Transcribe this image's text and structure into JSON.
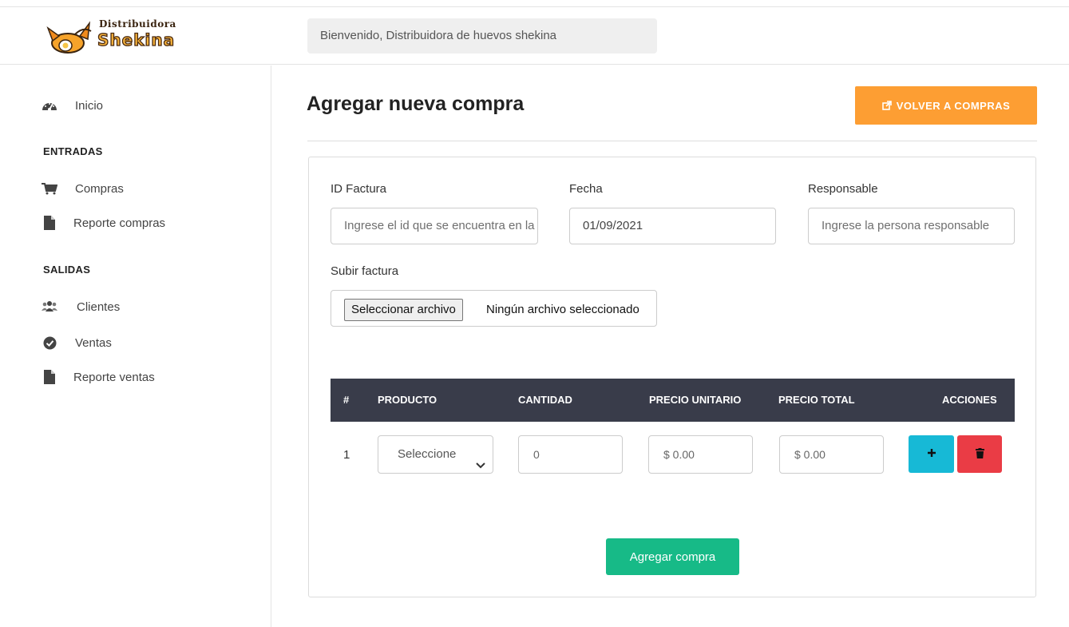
{
  "brand": {
    "line1": "Distribuidora",
    "line2": "Shekina"
  },
  "header": {
    "welcome": "Bienvenido, Distribuidora de huevos shekina"
  },
  "sidebar": {
    "home": {
      "label": "Inicio",
      "icon": "dashboard-icon"
    },
    "sections": [
      {
        "title": "ENTRADAS",
        "items": [
          {
            "label": "Compras",
            "icon": "cart-icon"
          },
          {
            "label": "Reporte compras",
            "icon": "document-icon"
          }
        ]
      },
      {
        "title": "SALIDAS",
        "items": [
          {
            "label": "Clientes",
            "icon": "users-icon"
          },
          {
            "label": "Ventas",
            "icon": "check-circle-icon"
          },
          {
            "label": "Reporte ventas",
            "icon": "document-icon"
          }
        ]
      }
    ]
  },
  "page": {
    "title": "Agregar nueva compra",
    "back_button": "VOLVER A COMPRAS",
    "accent_color": "#fd9e33"
  },
  "form": {
    "invoice_id": {
      "label": "ID Factura",
      "placeholder": "Ingrese el id que se encuentra en la factura",
      "value": ""
    },
    "date": {
      "label": "Fecha",
      "value": "01/09/2021"
    },
    "responsible": {
      "label": "Responsable",
      "placeholder": "Ingrese la persona responsable",
      "value": ""
    },
    "upload": {
      "label": "Subir factura",
      "button": "Seleccionar archivo",
      "status": "Ningún archivo seleccionado"
    }
  },
  "table": {
    "columns": [
      "#",
      "PRODUCTO",
      "CANTIDAD",
      "PRECIO UNITARIO",
      "PRECIO TOTAL",
      "ACCIONES"
    ],
    "rows": [
      {
        "index": "1",
        "product": "Seleccione",
        "quantity": "0",
        "unit_price": "$ 0.00",
        "total_price": "$ 0.00"
      }
    ]
  },
  "submit_button": "Agregar compra"
}
